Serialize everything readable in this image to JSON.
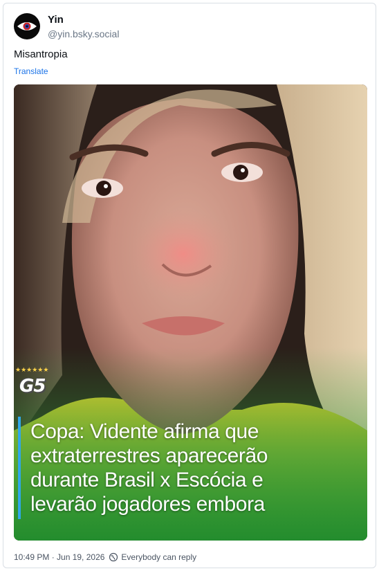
{
  "author": {
    "display_name": "Yin",
    "handle": "@yin.bsky.social"
  },
  "post": {
    "text": "Misantropia",
    "translate_label": "Translate"
  },
  "media": {
    "overlay_logo": "G5",
    "overlay_stars": "★★★★★★",
    "caption_lines": [
      "Copa: Vidente afirma que",
      "extraterrestres aparecerão",
      "durante Brasil x Escócia e",
      "levarão jogadores embora"
    ]
  },
  "footer": {
    "timestamp": "10:49 PM · Jun 19, 2026",
    "reply_setting": "Everybody can reply"
  },
  "icons": {
    "avatar": "eye-icon",
    "reply": "globe-icon"
  },
  "colors": {
    "link": "#1a73e8",
    "caption_accent": "#2fa8e8",
    "muted_text": "#4b5563"
  }
}
